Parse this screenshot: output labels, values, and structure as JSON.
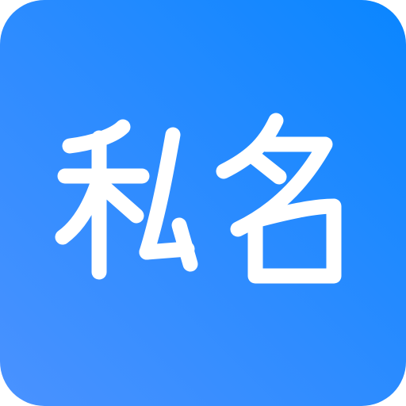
{
  "app_icon": {
    "text": "私名",
    "background_colors": [
      "#4a92ff",
      "#0a86ff"
    ],
    "glyph_color": "#ffffff"
  }
}
